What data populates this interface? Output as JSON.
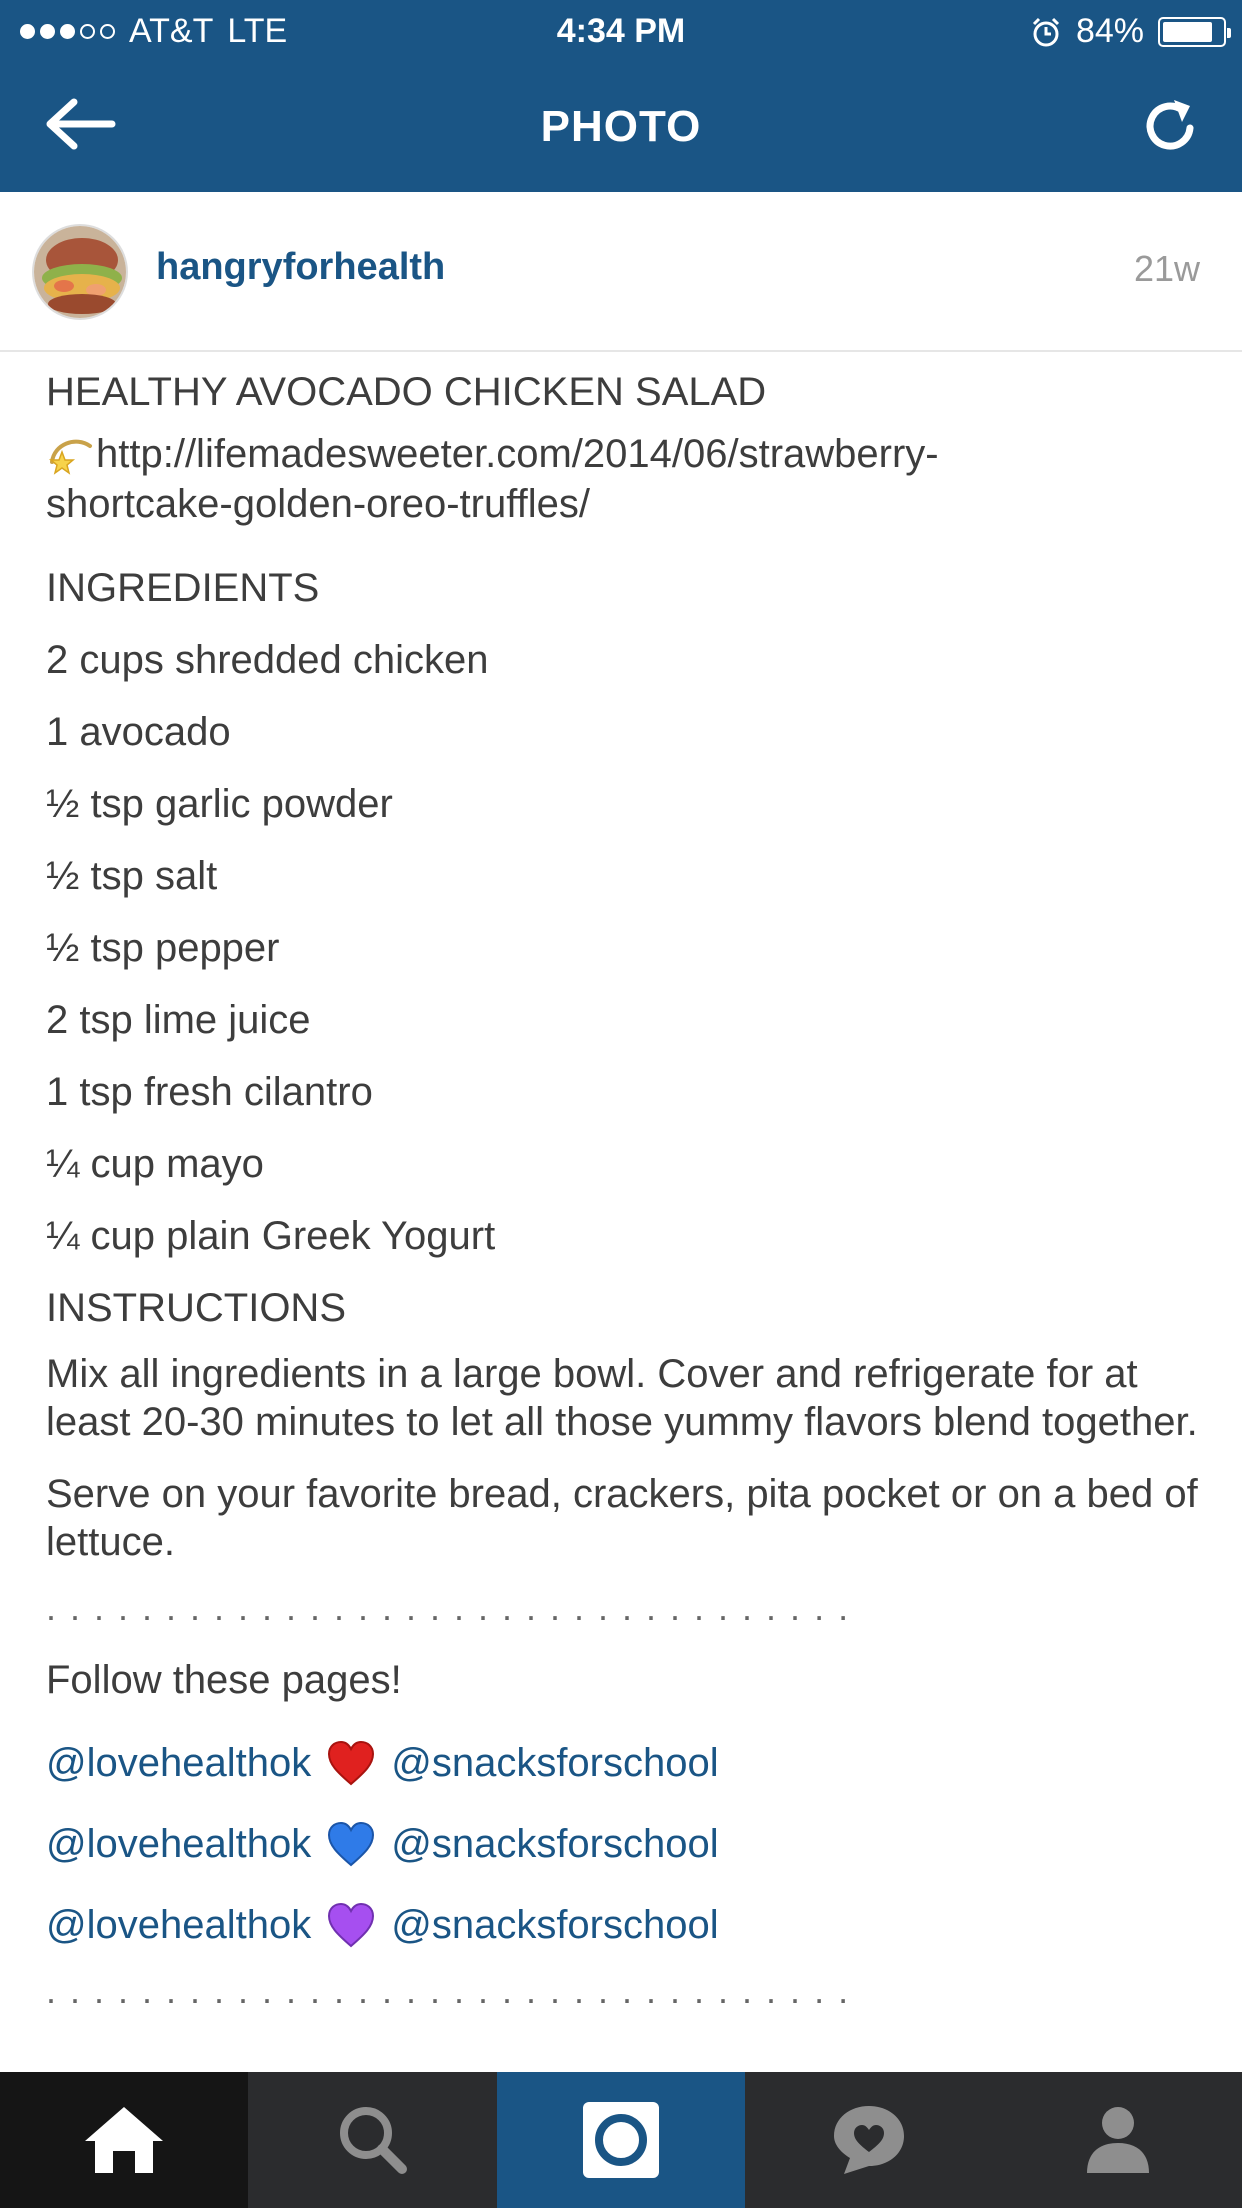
{
  "status_bar": {
    "carrier": "AT&T",
    "network": "LTE",
    "time": "4:34 PM",
    "battery_percent": "84%",
    "battery_level": 0.84,
    "signal_filled": 3,
    "signal_total": 5
  },
  "nav": {
    "title": "PHOTO",
    "back_icon": "arrow-left-icon",
    "refresh_icon": "refresh-icon"
  },
  "post": {
    "username": "hangryforhealth",
    "time_ago": "21w"
  },
  "caption": {
    "title": "HEALTHY AVOCADO CHICKEN SALAD",
    "link_line1": "http://lifemadesweeter.com/2014/06/strawberry-",
    "link_line2": "shortcake-golden-oreo-truffles/",
    "ingredients_heading": "INGREDIENTS",
    "ingredients": [
      "2 cups shredded chicken",
      "1 avocado",
      "½ tsp garlic powder",
      "½ tsp salt",
      "½ tsp pepper",
      "2 tsp lime juice",
      "1 tsp fresh cilantro",
      "¼ cup mayo",
      "¼ cup plain Greek Yogurt"
    ],
    "instructions_heading": "INSTRUCTIONS",
    "instructions_p1": "Mix all ingredients in a large bowl. Cover and refrigerate for at least 20-30 minutes to let all those yummy flavors blend together.",
    "instructions_p2": "Serve on your favorite bread, crackers, pita pocket or on a bed of lettuce.",
    "divider": "..................................",
    "follow_text": "Follow these pages!",
    "mentions": [
      {
        "left": "@lovehealthok",
        "right": "@snacksforschool",
        "heart_color": "#e0211f"
      },
      {
        "left": "@lovehealthok",
        "right": "@snacksforschool",
        "heart_color": "#2f7be8"
      },
      {
        "left": "@lovehealthok",
        "right": "@snacksforschool",
        "heart_color": "#a64ff0"
      }
    ],
    "divider_bottom": ".................................."
  },
  "tabbar": {
    "items": [
      "home-icon",
      "search-icon",
      "camera-icon",
      "activity-heart-icon",
      "profile-icon"
    ],
    "active": "home"
  },
  "colors": {
    "brand": "#1a5585",
    "text": "#3d3d3d",
    "muted": "#9a9a9a"
  }
}
